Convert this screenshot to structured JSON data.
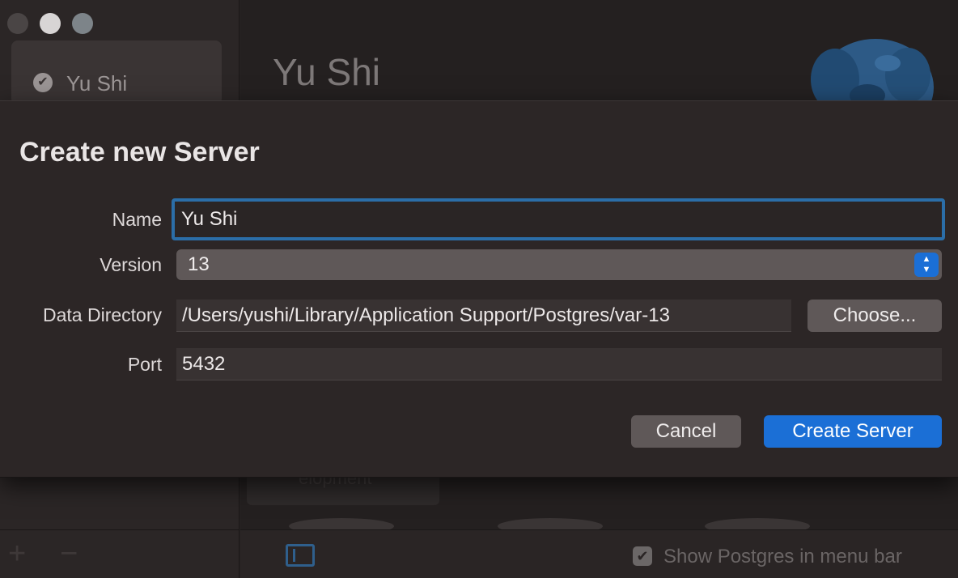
{
  "sidebar": {
    "server_item": {
      "label": "Yu Shi",
      "check_icon": "checkmark-circle-icon"
    },
    "add_label": "+",
    "remove_label": "−"
  },
  "main": {
    "server_title": "Yu Shi",
    "db_card_text": "elopment",
    "footer": {
      "menubar_checkbox": "✔",
      "menubar_label": "Show Postgres in menu bar",
      "menubar_checked": true
    }
  },
  "dialog": {
    "title": "Create new Server",
    "name_label": "Name",
    "name_value": "Yu Shi",
    "version_label": "Version",
    "version_value": "13",
    "version_stepper": "⌃\n⌄",
    "data_dir_label": "Data Directory",
    "data_dir_value": "/Users/yushi/Library/Application Support/Postgres/var-13",
    "choose_label": "Choose...",
    "port_label": "Port",
    "port_value": "5432",
    "cancel_label": "Cancel",
    "create_label": "Create Server"
  },
  "colors": {
    "accent": "#1b6fd6",
    "focus_ring": "#2b6ea8",
    "sheet_bg": "#2c2626"
  }
}
